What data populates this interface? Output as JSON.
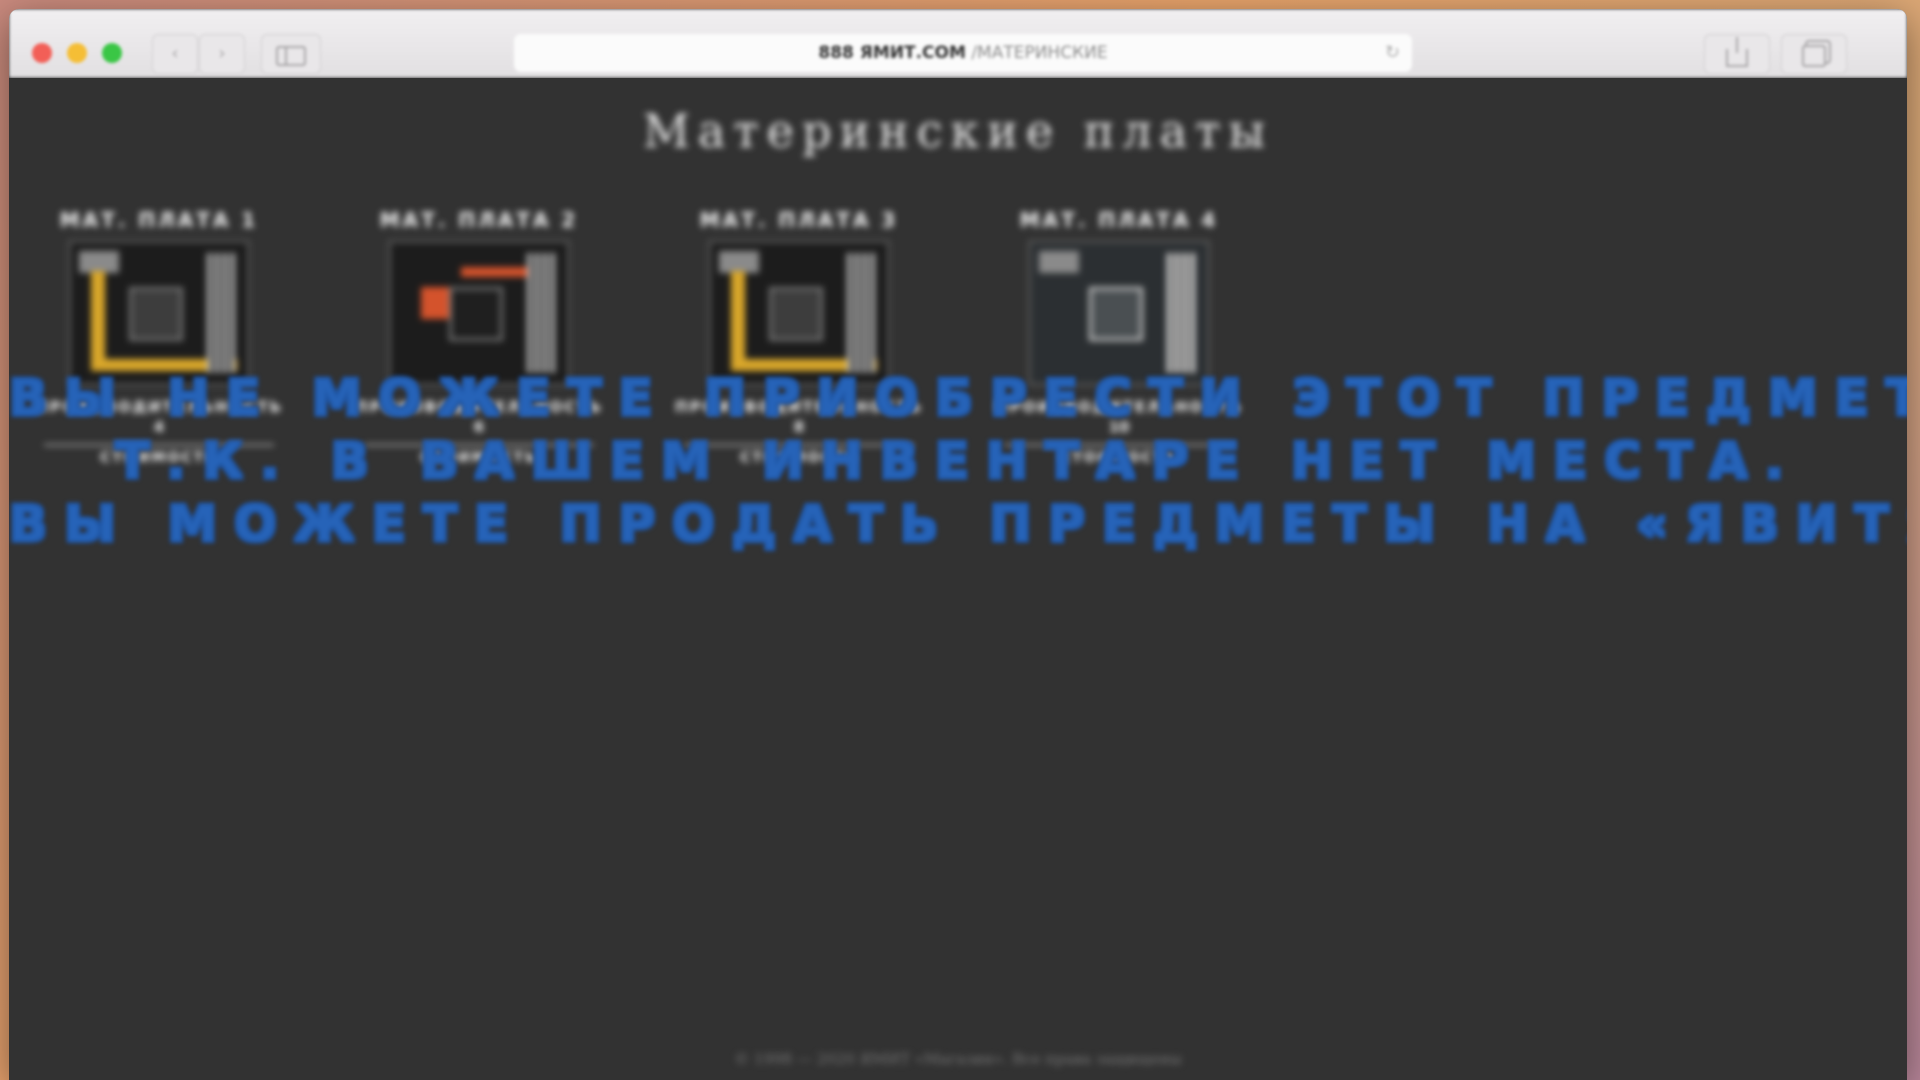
{
  "browser": {
    "url_domain": "888 ЯМИТ.COM",
    "url_path": "/МАТЕРИНСКИЕ",
    "back_icon": "chevron-left-icon",
    "forward_icon": "chevron-right-icon",
    "back_glyph": "‹",
    "forward_glyph": "›",
    "reload_glyph": "↻"
  },
  "page": {
    "title": "Материнские платы",
    "products": [
      {
        "name": "МАТ. ПЛАТА 1",
        "perf_label": "ПРОИЗВОДИТЕЛЬНОСТЬ",
        "perf_value": "4",
        "price": "СТОИМОСТЬ"
      },
      {
        "name": "МАТ. ПЛАТА 2",
        "perf_label": "ПРОИЗВОДИТЕЛЬНОСТЬ",
        "perf_value": "6",
        "price": "СТОИМОСТЬ"
      },
      {
        "name": "МАТ. ПЛАТА 3",
        "perf_label": "ПРОИЗВОДИТЕЛЬНОСТЬ",
        "perf_value": "8",
        "price": "СТОИМОСТЬ"
      },
      {
        "name": "МАТ. ПЛАТА 4",
        "perf_label": "ПРОИЗВОДИТЕЛЬНОСТЬ",
        "perf_value": "10",
        "price": "СТОИМОСТЬ"
      }
    ],
    "footer": "© 1998 — 2020 ЯМИТ «Магазин». Все права защищены"
  },
  "message": {
    "line1": "ВЫ НЕ МОЖЕТЕ ПРИОБРЕСТИ ЭТОТ ПРЕДМЕТ",
    "line2": "Т.К. В ВАШЕМ ИНВЕНТАРЕ НЕТ МЕСТА.",
    "line3": "ВЫ МОЖЕТЕ ПРОДАТЬ ПРЕДМЕТЫ НА «ЯВИТЯ»",
    "color": "#2663b8"
  }
}
